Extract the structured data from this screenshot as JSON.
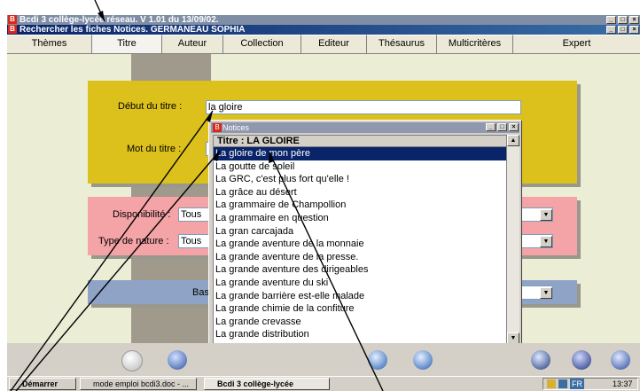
{
  "window": {
    "title": "Bcdi 3 collège-lycée réseau. V 1.01 du 13/09/02."
  },
  "child_window": {
    "title": "Rechercher les fiches Notices. GERMANEAU SOPHIA"
  },
  "tabs": [
    {
      "label": "Thèmes"
    },
    {
      "label": "Titre",
      "active": true
    },
    {
      "label": "Auteur"
    },
    {
      "label": "Collection"
    },
    {
      "label": "Editeur"
    },
    {
      "label": "Thésaurus"
    },
    {
      "label": "Multicritères"
    },
    {
      "label": "Expert"
    }
  ],
  "form": {
    "debut_label": "Début du titre :",
    "debut_value": "la gloire",
    "mot_label": "Mot du titre :",
    "disponibilite_label": "Disponibilité :",
    "disponibilite_value": "Tous",
    "type_label": "Type de nature :",
    "type_value": "Tous",
    "base_label": "Bas"
  },
  "notices": {
    "title": "Notices",
    "header": "Titre  : LA GLOIRE",
    "items": [
      "La gloire de mon père",
      "La goutte de soleil",
      "La GRC, c'est plus fort qu'elle !",
      "La grâce au désert",
      "La grammaire de Champollion",
      "La grammaire en question",
      "La gran carcajada",
      "La grande aventure de la monnaie",
      "La grande aventure de la presse.",
      "La grande aventure des dirigeables",
      "La grande aventure du ski",
      "La grande barrière est-elle malade",
      "La grande chimie de la confiture",
      "La grande crevasse",
      "La grande distribution"
    ],
    "selected_index": 0
  },
  "window_buttons": {
    "minimize": "_",
    "maximize": "□",
    "close": "×"
  },
  "taskbar": {
    "start": "Démarrer",
    "items": [
      "mode emploi bcdi3.doc - ...",
      "Bcdi 3 collège-lycée"
    ],
    "lang": "FR",
    "clock": "13:37"
  },
  "colors": {
    "title_active": "#0a246a",
    "panel_yellow": "#dcc01b",
    "panel_pink": "#f4a3a6",
    "panel_blue": "#8fa3c6",
    "selection": "#0a246a"
  },
  "icons": {
    "toolbar": [
      "refresh-icon",
      "settings-icon",
      "globe-icon",
      "globe-search-icon",
      "book-icon",
      "close-circle-icon",
      "help-icon"
    ]
  }
}
